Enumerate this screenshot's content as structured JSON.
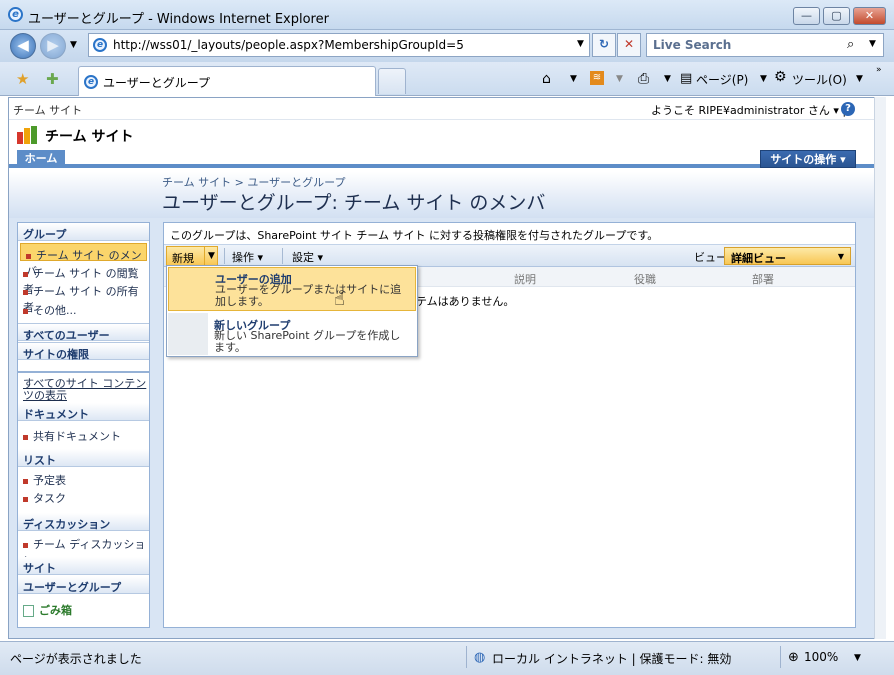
{
  "browser": {
    "title": "ユーザーとグループ - Windows Internet Explorer",
    "address": "http://wss01/_layouts/people.aspx?MembershipGroupId=5",
    "search_placeholder": "Live Search",
    "tab_title": "ユーザーとグループ",
    "page_menu": "ページ(P)",
    "tools_menu": "ツール(O)",
    "status_text": "ページが表示されました",
    "zone_text": "ローカル イントラネット | 保護モード: 無効",
    "zoom": "100%"
  },
  "sharepoint": {
    "top_site": "チーム サイト",
    "welcome": "ようこそ RIPE¥administrator さん",
    "site_title": "チーム サイト",
    "home_tab": "ホーム",
    "site_actions": "サイトの操作",
    "breadcrumb": "チーム サイト > ユーザーとグループ",
    "page_title": "ユーザーとグループ: チーム サイト のメンバ"
  },
  "leftnav": {
    "groups_header": "グループ",
    "groups": [
      "チーム サイト のメンバ",
      "チーム サイト の閲覧者",
      "チーム サイト の所有者",
      "その他..."
    ],
    "all_users": "すべてのユーザー",
    "site_permissions": "サイトの権限",
    "all_content": "すべてのサイト コンテンツの表示",
    "documents_header": "ドキュメント",
    "shared_docs": "共有ドキュメント",
    "lists_header": "リスト",
    "calendar": "予定表",
    "tasks": "タスク",
    "discussions_header": "ディスカッション",
    "team_discussion": "チーム ディスカッション",
    "sites_header": "サイト",
    "people_header": "ユーザーとグループ",
    "recycle_bin": "ごみ箱"
  },
  "content": {
    "description": "このグループは、SharePoint サイト チーム サイト に対する投稿権限を付与されたグループです。",
    "new_label": "新規",
    "actions_label": "操作",
    "settings_label": "設定",
    "view_label": "ビュー:",
    "view_value": "詳細ビュー",
    "columns": [
      "説明",
      "役職",
      "部署"
    ],
    "empty_message": "テムはありません。"
  },
  "menu": {
    "item1_title": "ユーザーの追加",
    "item1_desc": "ユーザーをグループまたはサイトに追加します。",
    "item2_title": "新しいグループ",
    "item2_desc": "新しい SharePoint グループを作成します。"
  }
}
